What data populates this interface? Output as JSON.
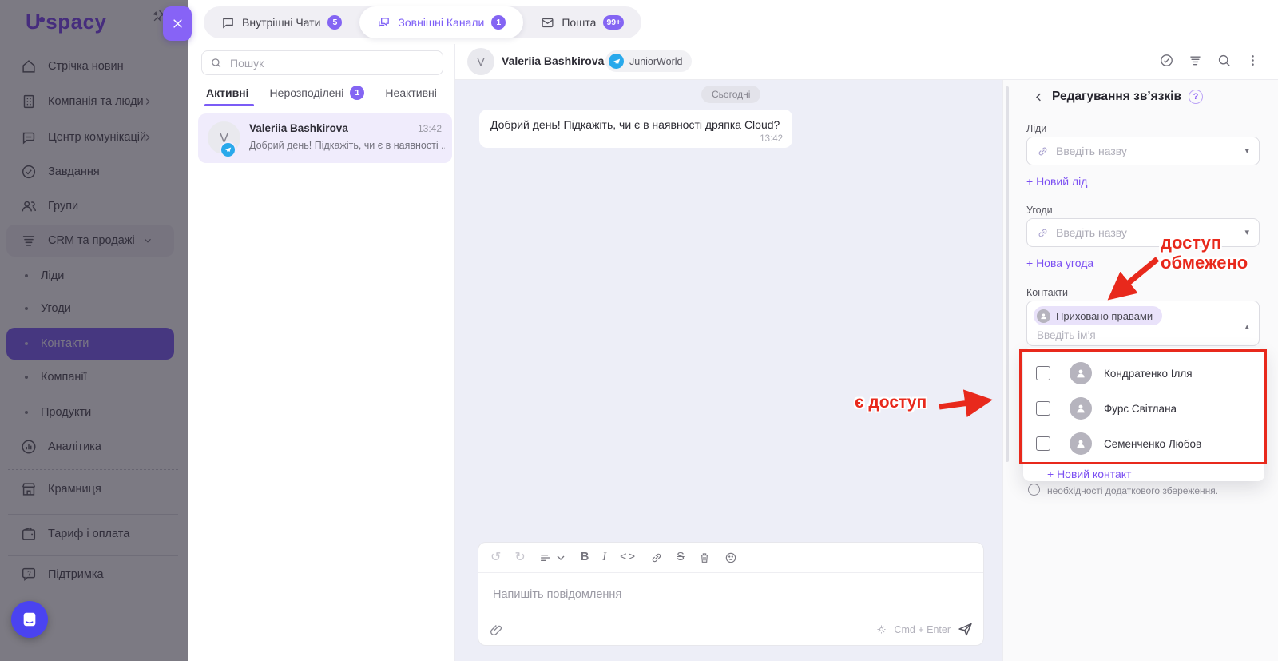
{
  "icons": {
    "undo": "↺",
    "redo": "↻",
    "bold": "B",
    "italic": "I",
    "strike": "S",
    "code": "<>",
    "caret_down": "▾",
    "caret_up": "▴",
    "question": "?",
    "info": "i"
  },
  "sidebar": {
    "logo_letter": "U",
    "logo_rest": "spacy",
    "items": [
      {
        "label": "Стрічка новин"
      },
      {
        "label": "Компанія та люди"
      },
      {
        "label": "Центр комунікацій"
      },
      {
        "label": "Завдання"
      },
      {
        "label": "Групи"
      },
      {
        "label": "CRM та продажі"
      },
      {
        "label": "Ліди"
      },
      {
        "label": "Угоди"
      },
      {
        "label": "Контакти"
      },
      {
        "label": "Компанії"
      },
      {
        "label": "Продукти"
      },
      {
        "label": "Аналітика"
      },
      {
        "label": "Крамниця"
      },
      {
        "label": "Тариф і оплата"
      },
      {
        "label": "Підтримка"
      }
    ]
  },
  "topbar": {
    "tabs": [
      {
        "label": "Внутрішні Чати",
        "badge": "5"
      },
      {
        "label": "Зовнішні Канали",
        "badge": "1"
      },
      {
        "label": "Пошта",
        "badge": "99+"
      }
    ]
  },
  "chat_list": {
    "search_placeholder": "Пошук",
    "tabs": [
      {
        "label": "Активні"
      },
      {
        "label": "Нерозподілені",
        "badge": "1"
      },
      {
        "label": "Неактивні"
      }
    ],
    "conversation": {
      "initial": "V",
      "name": "Valeriia Bashkirova",
      "time": "13:42",
      "preview": "Добрий день! Підкажіть, чи є в наявності ..."
    }
  },
  "chat": {
    "initial": "V",
    "name": "Valeriia Bashkirova",
    "channel": "JuniorWorld",
    "date_divider": "Сьогодні",
    "message": {
      "text": "Добрий день! Підкажіть, чи є в наявності дряпка Cloud?",
      "time": "13:42"
    },
    "composer": {
      "placeholder": "Напишіть повідомлення",
      "shortcut": "Cmd + Enter"
    }
  },
  "panel": {
    "title": "Редагування зв’язків",
    "leads": {
      "label": "Ліди",
      "placeholder": "Введіть назву",
      "add": "+ Новий лід"
    },
    "deals": {
      "label": "Угоди",
      "placeholder": "Введіть назву",
      "add": "+ Нова угода"
    },
    "contacts": {
      "label": "Контакти",
      "chip": "Приховано правами",
      "placeholder": "Введіть ім’я",
      "options": [
        {
          "name": "Кондратенко Ілля"
        },
        {
          "name": "Фурс Світлана"
        },
        {
          "name": "Семенченко Любов"
        }
      ],
      "add": "+ Новий контакт",
      "note": "необхідності додаткового збереження."
    }
  },
  "annotations": {
    "restricted_line1": "доступ",
    "restricted_line2": "обмежено",
    "access": "є доступ"
  }
}
